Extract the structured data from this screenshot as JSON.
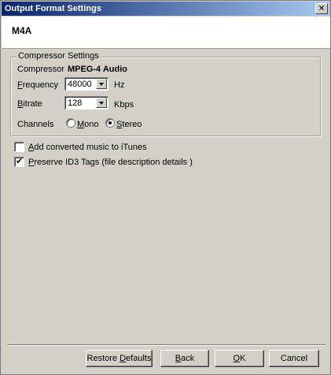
{
  "window": {
    "title": "Output Format Settings",
    "close_glyph": "✕"
  },
  "header": {
    "format": "M4A"
  },
  "compressor_group": {
    "legend": "Compressor Settings",
    "compressor_label": "Compressor",
    "compressor_value": "MPEG-4 Audio",
    "frequency": {
      "label_u": "F",
      "label_rest": "requency",
      "value": "48000",
      "unit": "Hz"
    },
    "bitrate": {
      "label_u": "B",
      "label_rest": "itrate",
      "value": "128",
      "unit": "Kbps"
    },
    "channels": {
      "label": "Channels",
      "mono": {
        "label_u": "M",
        "label_rest": "ono",
        "checked": false
      },
      "stereo": {
        "label_u": "S",
        "label_rest": "tereo",
        "checked": true
      }
    }
  },
  "options": {
    "itunes": {
      "label_u": "A",
      "label_rest": "dd converted music to iTunes",
      "checked": false
    },
    "id3": {
      "label_u": "P",
      "label_rest": "reserve ID3 Tags (file description details )",
      "checked": true
    }
  },
  "buttons": {
    "restore": {
      "pre": "Restore ",
      "u": "D",
      "post": "efaults"
    },
    "back": {
      "pre": "",
      "u": "B",
      "post": "ack"
    },
    "ok": {
      "pre": "",
      "u": "O",
      "post": "K"
    },
    "cancel": {
      "pre": "",
      "u": "",
      "post": "Cancel"
    }
  }
}
